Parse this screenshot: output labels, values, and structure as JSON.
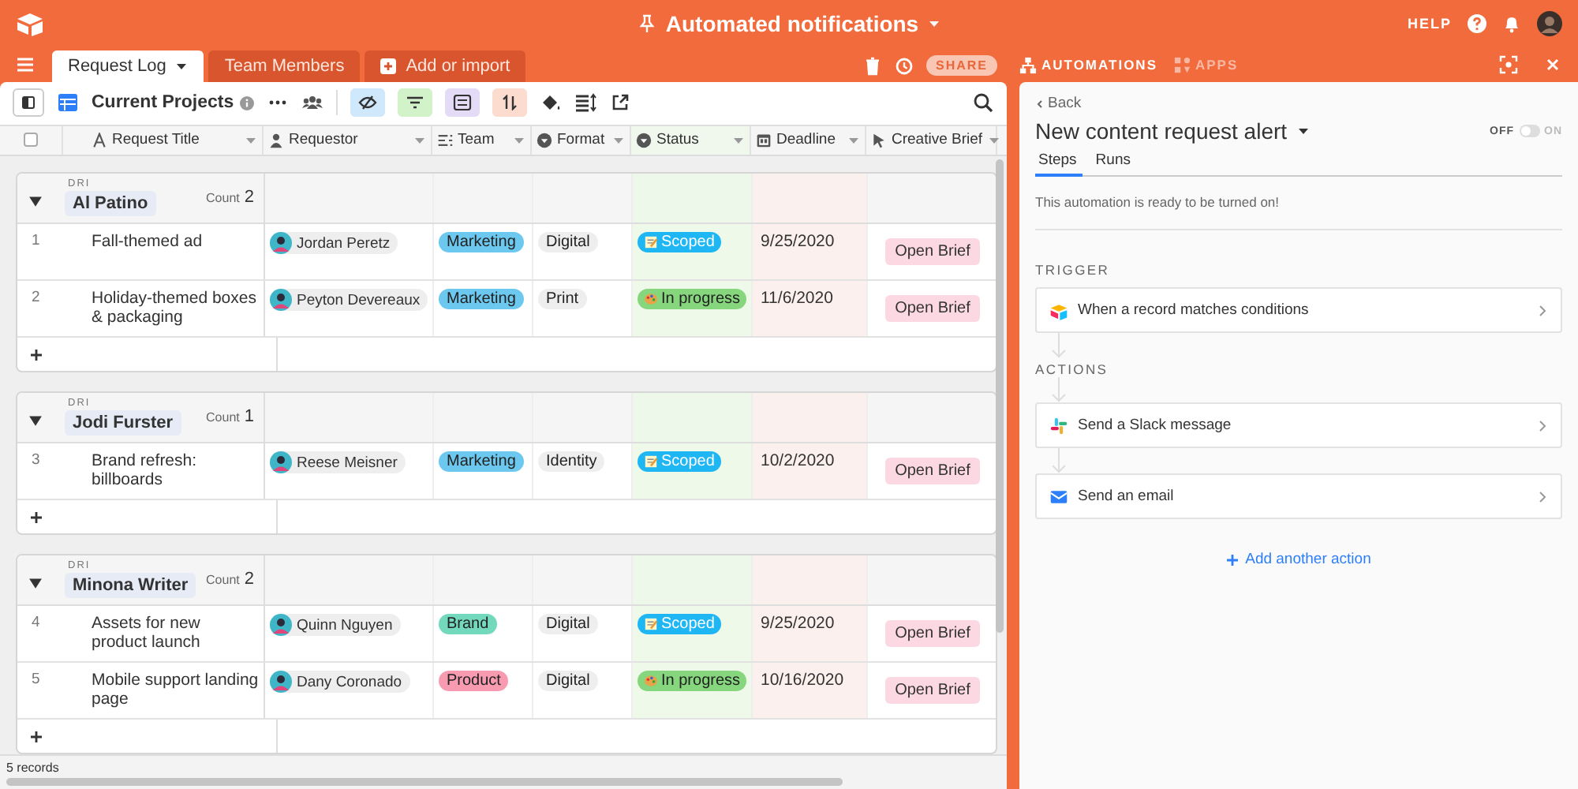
{
  "header": {
    "title": "Automated notifications",
    "help": "HELP"
  },
  "tabs": [
    {
      "label": "Request Log",
      "selected": true
    },
    {
      "label": "Team Members",
      "selected": false
    }
  ],
  "add_import": "Add or import",
  "share": "SHARE",
  "panel_tabs": [
    {
      "label": "AUTOMATIONS",
      "kind": "automations",
      "selected": true
    },
    {
      "label": "APPS",
      "kind": "apps",
      "selected": false
    }
  ],
  "view": {
    "name": "Current Projects"
  },
  "select_all": {
    "checked": false
  },
  "columns": [
    {
      "label": "Request Title",
      "kind": "text"
    },
    {
      "label": "Requestor",
      "kind": "user"
    },
    {
      "label": "Team",
      "kind": "multi"
    },
    {
      "label": "Format",
      "kind": "select"
    },
    {
      "label": "Status",
      "kind": "select"
    },
    {
      "label": "Deadline",
      "kind": "date"
    },
    {
      "label": "Creative Brief",
      "kind": "button"
    }
  ],
  "groups": [
    {
      "field": "DRI",
      "name": "Al Patino",
      "count_label": "Count",
      "count": "2",
      "rows": [
        {
          "number": "1",
          "title": "Fall-themed ad",
          "requestor": "Jordan Peretz",
          "team": {
            "label": "Marketing",
            "color": "#6cc8ef"
          },
          "format": "Digital",
          "status": {
            "label": "Scoped",
            "kind": "scoped",
            "color": "#1fb6f4"
          },
          "deadline": "9/25/2020",
          "brief": "Open Brief"
        },
        {
          "number": "2",
          "title": "Holiday-themed boxes & packaging",
          "requestor": "Peyton Devereaux",
          "team": {
            "label": "Marketing",
            "color": "#6cc8ef"
          },
          "format": "Print",
          "status": {
            "label": "In progress",
            "kind": "progress",
            "color": "#86d67e"
          },
          "deadline": "11/6/2020",
          "brief": "Open Brief"
        }
      ]
    },
    {
      "field": "DRI",
      "name": "Jodi Furster",
      "count_label": "Count",
      "count": "1",
      "rows": [
        {
          "number": "3",
          "title": "Brand refresh: billboards",
          "requestor": "Reese Meisner",
          "team": {
            "label": "Marketing",
            "color": "#6cc8ef"
          },
          "format": "Identity",
          "status": {
            "label": "Scoped",
            "kind": "scoped",
            "color": "#1fb6f4"
          },
          "deadline": "10/2/2020",
          "brief": "Open Brief"
        }
      ]
    },
    {
      "field": "DRI",
      "name": "Minona Writer",
      "count_label": "Count",
      "count": "2",
      "rows": [
        {
          "number": "4",
          "title": "Assets for new product launch",
          "requestor": "Quinn Nguyen",
          "team": {
            "label": "Brand",
            "color": "#72d9bc"
          },
          "format": "Digital",
          "status": {
            "label": "Scoped",
            "kind": "scoped",
            "color": "#1fb6f4"
          },
          "deadline": "9/25/2020",
          "brief": "Open Brief"
        },
        {
          "number": "5",
          "title": "Mobile support landing page",
          "requestor": "Dany Coronado",
          "team": {
            "label": "Product",
            "color": "#f89bb1"
          },
          "format": "Digital",
          "status": {
            "label": "In progress",
            "kind": "progress",
            "color": "#86d67e"
          },
          "deadline": "10/16/2020",
          "brief": "Open Brief"
        }
      ]
    }
  ],
  "footer": "5 records",
  "panel": {
    "back": "Back",
    "title": "New content request alert",
    "toggle": {
      "off_label": "OFF",
      "on_label": "ON",
      "on": false
    },
    "tabs": [
      {
        "label": "Steps",
        "selected": true
      },
      {
        "label": "Runs",
        "selected": false
      }
    ],
    "message": "This automation is ready to be turned on!",
    "trigger_heading": "TRIGGER",
    "trigger": {
      "label": "When a record matches conditions",
      "kind": "record"
    },
    "actions_heading": "ACTIONS",
    "actions": [
      {
        "label": "Send a Slack message",
        "kind": "slack"
      },
      {
        "label": "Send an email",
        "kind": "email"
      }
    ],
    "add_action": "Add another action"
  }
}
